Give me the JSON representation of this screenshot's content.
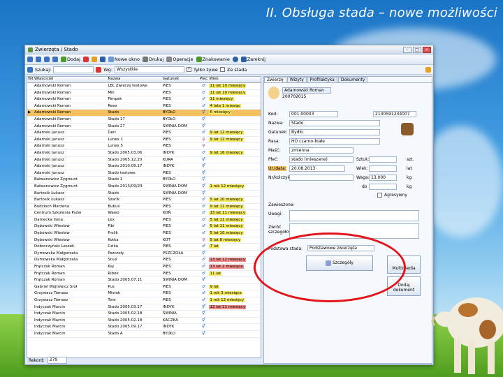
{
  "slide_title": "II. Obsługa stada – nowe możliwości",
  "window": {
    "title": "Zwierzęta / Stado"
  },
  "toolbar": {
    "add": "Dodaj",
    "new_window": "Nowe okno",
    "print": "Drukuj",
    "operations": "Operacje",
    "marking": "Znakowanie",
    "close": "Zamknij"
  },
  "searchbar": {
    "search_label": "Szukaj:",
    "view_label": "Wg:",
    "view_value": "Wszystkie",
    "only_alive": "Tylko żywe",
    "from_herd": "Ze stada"
  },
  "grid": {
    "headers": [
      "Wł.",
      "Właściciel",
      "Nazwa",
      "Gatunek",
      "Płeć",
      "Wiek"
    ],
    "rows": [
      [
        "Adamowski Roman",
        "LEŁ Zwierzę testowe",
        "PIES",
        "♂",
        "11 lat 10 miesięcy",
        "y"
      ],
      [
        "Adamowski Roman",
        "Mili",
        "PIES",
        "♂",
        "11 lat 10 miesięcy",
        "y"
      ],
      [
        "Adamowski Roman",
        "Pimpek",
        "PIES",
        "♂",
        "11 miesięcy",
        "y"
      ],
      [
        "Adamowski Roman",
        "Reex",
        "PIES",
        "♂",
        "4 lata 1 miesiąc",
        "y"
      ],
      [
        "Adamowski Roman",
        "Stado",
        "BYDŁO",
        "⚥",
        "6 miesięcy",
        "y"
      ],
      [
        "Adamowski Roman",
        "Stado 17",
        "BYDŁO",
        "⚥",
        "",
        "n"
      ],
      [
        "Adamowski Roman",
        "Stado 27",
        "ŚWINIA DOM",
        "⚥",
        "",
        "n"
      ],
      [
        "Adamski Janusz",
        "Deri",
        "PIES",
        "♂",
        "9 lat 12 miesięcy",
        "y"
      ],
      [
        "Adamski Janusz",
        "Lunex 1",
        "PIES",
        "♀",
        "9 lat 12 miesięcy",
        "y"
      ],
      [
        "Adamski Janusz",
        "Lunex 5",
        "PIES",
        "♀",
        "",
        "n"
      ],
      [
        "Adamski Janusz",
        "Stado 2005.03.06",
        "INDYK",
        "♂",
        "9 lat 16 miesięcy",
        "y"
      ],
      [
        "Adamski Janusz",
        "Stado 2005.12.20",
        "KURA",
        "⚥",
        "",
        "n"
      ],
      [
        "Adamski Janusz",
        "Stado 2010.09.17",
        "INDYK",
        "⚥",
        "",
        "n"
      ],
      [
        "Adamski Janusz",
        "Stado testowe",
        "PIES",
        "⚥",
        "",
        "n"
      ],
      [
        "Bałwanowicz Zygmunt",
        "Stado 1",
        "BYDŁO",
        "⚥",
        "",
        "n"
      ],
      [
        "Bałwanowicz Zygmunt",
        "Stado 2013/09/23",
        "ŚWINIA DOM",
        "⚥",
        "1 rok 12 miesięcy",
        "y"
      ],
      [
        "Bartosik Łukasz",
        "Stado",
        "ŚWINIA DOM",
        "⚥",
        "",
        "n"
      ],
      [
        "Bartosik Łukasz",
        "Szarik",
        "PIES",
        "♂",
        "5 lat 10 miesięcy",
        "y"
      ],
      [
        "Bodzioch Marzena",
        "Bubuś",
        "PIES",
        "♂",
        "9 lat 11 miesięcy",
        "y"
      ],
      [
        "Centrum Szkolenia Psów",
        "Wawo",
        "KOŃ",
        "♂",
        "15 lat 11 miesięcy",
        "y"
      ],
      [
        "Dameckа Ilona",
        "Lex",
        "PIES",
        "♂",
        "5 lat 11 miesięcy",
        "y"
      ],
      [
        "Dębowski Wiesław",
        "Fibi",
        "PIES",
        "♂",
        "5 lat 11 miesięcy",
        "y"
      ],
      [
        "Dębowski Wiesław",
        "Frolik",
        "PIES",
        "♂",
        "5 lat 10 miesięcy",
        "y"
      ],
      [
        "Dębowski Wiesław",
        "Kotka",
        "KOT",
        "♀",
        "5 lat 8 miesięcy",
        "y"
      ],
      [
        "Dobroczyński Leszek",
        "Czika",
        "PIES",
        "♂",
        "7 lat",
        "y"
      ],
      [
        "Dymowska Małgorzata",
        "Pszczoły",
        "PSZCZOŁA",
        "⚥",
        "",
        "n"
      ],
      [
        "Dymowska Małgorzata",
        "Snuś",
        "PIES",
        "♂",
        "13 lat 12 miesięcy",
        "r"
      ],
      [
        "Frątczak Roman",
        "Kaj",
        "PIES",
        "♂",
        "13 lat 2 miesiące",
        "r"
      ],
      [
        "Frątczak Roman",
        "Ribok",
        "PIES",
        "♂",
        "11 lat",
        "y"
      ],
      [
        "Frątczak Roman",
        "Stado 2005.07.11",
        "ŚWINIA DOM",
        "⚥",
        "",
        "n"
      ],
      [
        "Gabriel Wojtowicz Sroł",
        "Pus",
        "PIES",
        "♂",
        "9 lat",
        "y"
      ],
      [
        "Grzywacz Tomasz",
        "Mistok",
        "PIES",
        "♂",
        "1 rok 3 miesiące",
        "y"
      ],
      [
        "Grzywacz Tomasz",
        "Tore",
        "PIES",
        "♂",
        "1 rok 12 miesięcy",
        "y"
      ],
      [
        "Indyczak Marcin",
        "Stado 2005.03.17",
        "INDYK",
        "⚥",
        "12 lat 11 miesięcy",
        "r"
      ],
      [
        "Indyczak Marcin",
        "Stado 2005.02.18",
        "ŚWINIA",
        "⚥",
        "",
        "n"
      ],
      [
        "Indyczak Marcin",
        "Stado 2005.02.18",
        "KACZKA",
        "⚥",
        "",
        "n"
      ],
      [
        "Indyczak Marcin",
        "Stado 2005.09.17",
        "INDYK",
        "⚥",
        "",
        "n"
      ],
      [
        "Indyczak Marcin",
        "Stado A",
        "BYDŁO",
        "⚥",
        "",
        "n"
      ]
    ],
    "selected_index": 4,
    "footer_label": "Rekord:",
    "footer_count": "279"
  },
  "detail": {
    "tabs": [
      "Zwierzę",
      "Wizyty",
      "Profilaktyka",
      "Dokumenty"
    ],
    "owner_name": "Adamowski Roman",
    "owner_id": "200702015",
    "fields": {
      "id_label": "Kod:",
      "id_value": "001.00003",
      "chip_value": "2130591234007",
      "name_label": "Nazwa:",
      "name_value": "Stado",
      "species_label": "Gatunek:",
      "species_value": "Bydło",
      "breed_label": "Rasa:",
      "breed_value": "HO czarno-białe",
      "color_label": "Maść:",
      "color_value": "zmienna",
      "sex_label": "Płeć:",
      "sex_value": "stado (mieszane)",
      "born_label": "Ur./data:",
      "born_value": "20.08.2013",
      "desc_label": "Nr/kolczyki:",
      "count_label": "Sztuk:",
      "count_unit": "szt.",
      "age_label": "Wiek:",
      "age_unit": "lat",
      "weight_label": "Waga:",
      "weight_value": "13,000",
      "weight_unit": "kg",
      "dose_label": "do",
      "dose_unit": "kg",
      "aggressive": "Agresywny",
      "died_label": "Zawieszone:",
      "notes_label": "Uwagi:",
      "info_label": "Zwróć szczegółowe:",
      "sub_label": "Podstawa stada:",
      "sub_value": "Podstawowe zwierzęta"
    },
    "details_button": "Szczegóły",
    "multimedia_button": "Multimedia",
    "add_doc_button": "Dodaj dokument"
  }
}
